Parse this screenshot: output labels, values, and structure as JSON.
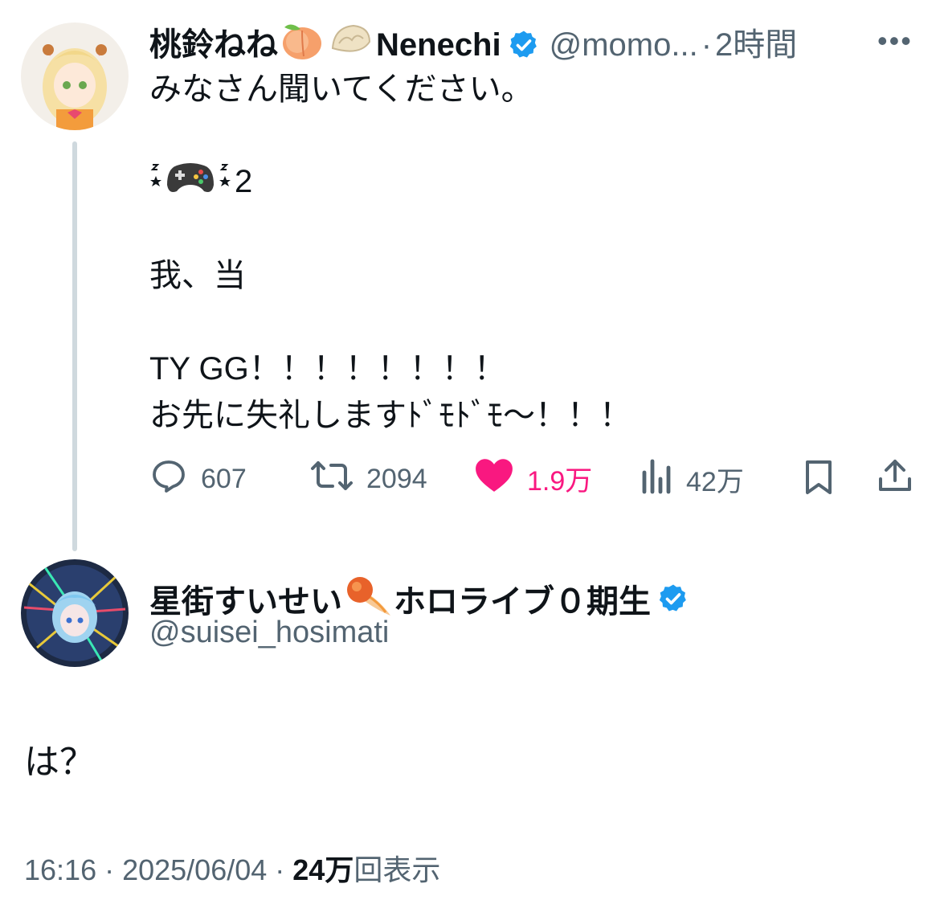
{
  "parent_tweet": {
    "display_name_prefix": "桃鈴ねね",
    "display_name_suffix": "Nenechi",
    "handle": "@momo...",
    "separator": "·",
    "time_ago": "2時間",
    "more": "•••",
    "lines": {
      "l1": "みなさん聞いてください。",
      "l2_suffix": "2",
      "l3": "我、当",
      "l4": "TY GG！！！！！！！！",
      "l5": "お先に失礼しますﾄﾞﾓﾄﾞﾓ〜！！！"
    },
    "actions": {
      "replies": "607",
      "reposts": "2094",
      "likes": "1.9万",
      "views": "42万"
    },
    "accent_like": "#f91880",
    "verified_color": "#1d9bf0"
  },
  "reply_tweet": {
    "display_name": "星街すいせい",
    "display_name_suffix": "ホロライブ０期生",
    "handle": "@suisei_hosimati",
    "text": "は？",
    "meta": {
      "time": "16:16",
      "sep1": " · ",
      "date": "2025/06/04",
      "sep2": " · ",
      "views_count": "24万",
      "views_label": "回表示"
    }
  }
}
